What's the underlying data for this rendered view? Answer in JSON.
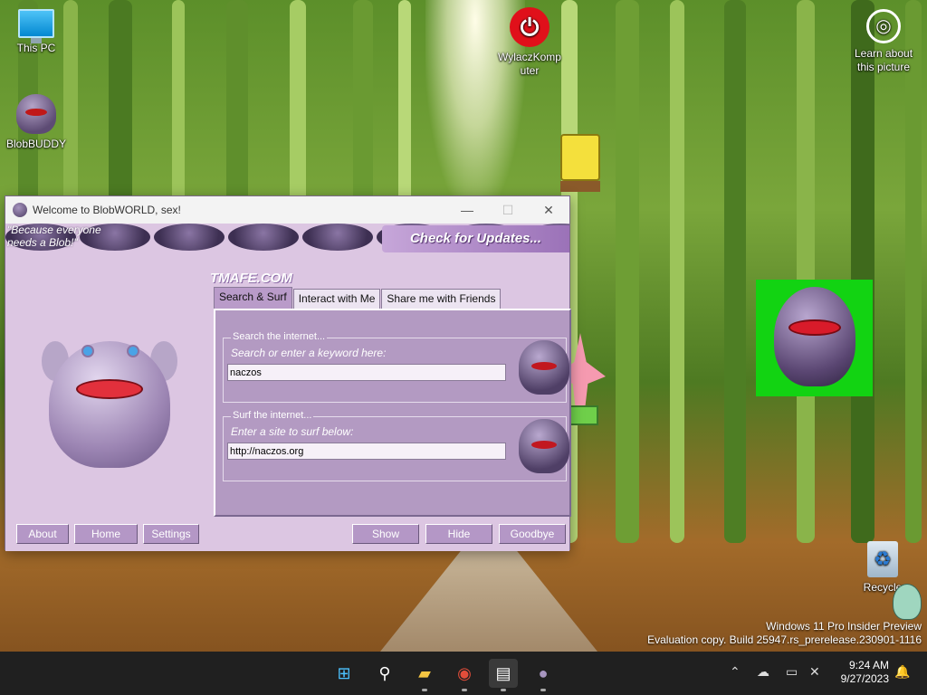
{
  "desktop": {
    "icons": [
      {
        "label": "This PC",
        "icon": "computer-icon"
      },
      {
        "label": "BlobBUDDY",
        "icon": "blob-shortcut-icon"
      },
      {
        "label": "WylaczKomp uter",
        "icon": "power-icon"
      },
      {
        "label": "Learn about this picture",
        "icon": "camera-icon"
      },
      {
        "label": "Recycle",
        "icon": "recycle-bin-icon"
      }
    ],
    "watermark_line1": "Windows 11 Pro Insider Preview",
    "watermark_line2": "Evaluation copy. Build 25947.rs_prerelease.230901-1116"
  },
  "window": {
    "title": "Welcome to BlobWORLD, sex!",
    "slogan_line1": "\"Because everyone",
    "slogan_line2": "needs a Blob!\"",
    "updates_label": "Check for Updates...",
    "brand": "TMAFE.COM",
    "tabs": [
      {
        "label": "Search & Surf",
        "active": true
      },
      {
        "label": "Interact with Me",
        "active": false
      },
      {
        "label": "Share me with Friends",
        "active": false
      }
    ],
    "search": {
      "legend": "Search the internet...",
      "hint": "Search or enter a keyword here:",
      "value": "naczos"
    },
    "surf": {
      "legend": "Surf the internet...",
      "hint": "Enter a site to surf below:",
      "value": "http://naczos.org"
    },
    "buttons": [
      "About",
      "Home",
      "Settings",
      "Show",
      "Hide",
      "Goodbye"
    ]
  },
  "taskbar": {
    "time": "9:24 AM",
    "date": "9/27/2023",
    "apps": [
      "start-icon",
      "search-icon",
      "file-explorer-icon",
      "chrome-icon",
      "files-app-icon",
      "blob-app-icon"
    ]
  },
  "colors": {
    "window_bg": "#dcc6e2",
    "panel_bg": "#b39ac2",
    "green_tile": "#12d312",
    "taskbar_bg": "#202020"
  }
}
